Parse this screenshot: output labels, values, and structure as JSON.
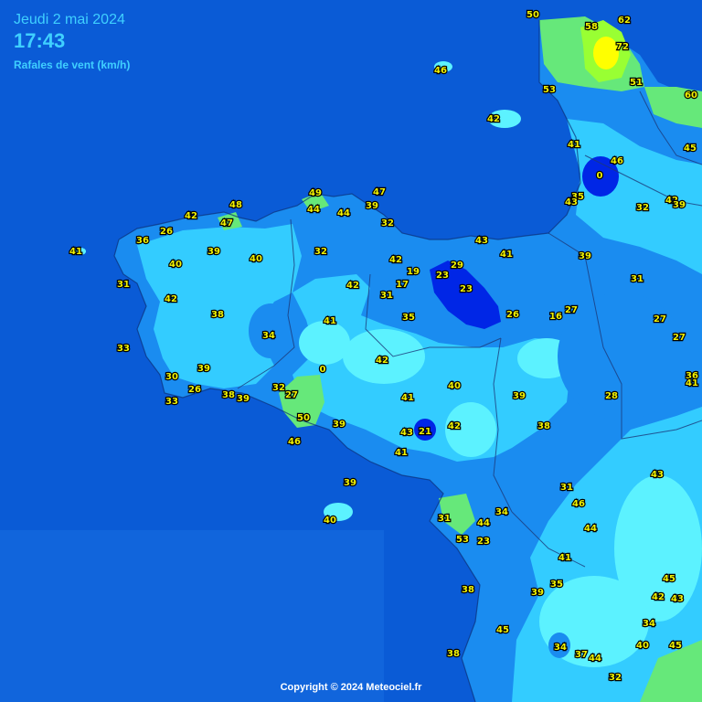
{
  "header": {
    "date": "Jeudi 2 mai 2024",
    "time": "17:43",
    "subtitle": "Rafales de vent (km/h)"
  },
  "footer": {
    "copyright": "Copyright © 2024 Meteociel.fr"
  },
  "colors": {
    "sea": "#0a5bd6",
    "sea_light": "#1f78e8",
    "land_light": "#33ccff",
    "land_mid": "#1a8cf0",
    "land_dark": "#0026e6",
    "cyan": "#5cf2ff",
    "green": "#66e87a",
    "lime": "#99ff33",
    "yellow": "#ffff00",
    "label": "#f2f200"
  },
  "stations": [
    {
      "id": "s1",
      "value": "50"
    },
    {
      "id": "s2",
      "value": "58"
    },
    {
      "id": "s3",
      "value": "62"
    },
    {
      "id": "s4",
      "value": "72"
    },
    {
      "id": "s5",
      "value": "46"
    },
    {
      "id": "s6",
      "value": "53"
    },
    {
      "id": "s7",
      "value": "51"
    },
    {
      "id": "s8",
      "value": "60"
    },
    {
      "id": "s9",
      "value": "42"
    },
    {
      "id": "s10",
      "value": "41"
    },
    {
      "id": "s11",
      "value": "46"
    },
    {
      "id": "s12",
      "value": "45"
    },
    {
      "id": "s13",
      "value": "0"
    },
    {
      "id": "s14",
      "value": "35"
    },
    {
      "id": "s15",
      "value": "43"
    },
    {
      "id": "s16",
      "value": "32"
    },
    {
      "id": "s17",
      "value": "42"
    },
    {
      "id": "s18",
      "value": "39"
    },
    {
      "id": "s19",
      "value": "48"
    },
    {
      "id": "s20",
      "value": "49"
    },
    {
      "id": "s21",
      "value": "47"
    },
    {
      "id": "s22",
      "value": "42"
    },
    {
      "id": "s23",
      "value": "44"
    },
    {
      "id": "s24",
      "value": "44"
    },
    {
      "id": "s25",
      "value": "39"
    },
    {
      "id": "s26",
      "value": "47"
    },
    {
      "id": "s27",
      "value": "26"
    },
    {
      "id": "s28",
      "value": "32"
    },
    {
      "id": "s29",
      "value": "36"
    },
    {
      "id": "s30",
      "value": "43"
    },
    {
      "id": "s31",
      "value": "41"
    },
    {
      "id": "s32",
      "value": "41"
    },
    {
      "id": "s33",
      "value": "39"
    },
    {
      "id": "s34",
      "value": "32"
    },
    {
      "id": "s35",
      "value": "39"
    },
    {
      "id": "s36",
      "value": "40"
    },
    {
      "id": "s37",
      "value": "42"
    },
    {
      "id": "s38",
      "value": "29"
    },
    {
      "id": "s39",
      "value": "31"
    },
    {
      "id": "s40",
      "value": "19"
    },
    {
      "id": "s41",
      "value": "23"
    },
    {
      "id": "s42",
      "value": "31"
    },
    {
      "id": "s43",
      "value": "40"
    },
    {
      "id": "s44",
      "value": "42"
    },
    {
      "id": "s45",
      "value": "17"
    },
    {
      "id": "s46",
      "value": "23"
    },
    {
      "id": "s47",
      "value": "31"
    },
    {
      "id": "s48",
      "value": "27"
    },
    {
      "id": "s49",
      "value": "38"
    },
    {
      "id": "s50",
      "value": "41"
    },
    {
      "id": "s51",
      "value": "35"
    },
    {
      "id": "s52",
      "value": "26"
    },
    {
      "id": "s53",
      "value": "16"
    },
    {
      "id": "s54",
      "value": "27"
    },
    {
      "id": "s55",
      "value": "33"
    },
    {
      "id": "s56",
      "value": "34"
    },
    {
      "id": "s57",
      "value": "27"
    },
    {
      "id": "s58",
      "value": "42"
    },
    {
      "id": "s59",
      "value": "39"
    },
    {
      "id": "s60",
      "value": "0"
    },
    {
      "id": "s61",
      "value": "42"
    },
    {
      "id": "s62",
      "value": "36"
    },
    {
      "id": "s63",
      "value": "41"
    },
    {
      "id": "s64",
      "value": "30"
    },
    {
      "id": "s65",
      "value": "40"
    },
    {
      "id": "s66",
      "value": "26"
    },
    {
      "id": "s67",
      "value": "38"
    },
    {
      "id": "s68",
      "value": "39"
    },
    {
      "id": "s69",
      "value": "32"
    },
    {
      "id": "s70",
      "value": "27"
    },
    {
      "id": "s71",
      "value": "41"
    },
    {
      "id": "s72",
      "value": "39"
    },
    {
      "id": "s73",
      "value": "28"
    },
    {
      "id": "s74",
      "value": "33"
    },
    {
      "id": "s75",
      "value": "50"
    },
    {
      "id": "s76",
      "value": "39"
    },
    {
      "id": "s77",
      "value": "21"
    },
    {
      "id": "s78",
      "value": "42"
    },
    {
      "id": "s79",
      "value": "38"
    },
    {
      "id": "s80",
      "value": "46"
    },
    {
      "id": "s81",
      "value": "43"
    },
    {
      "id": "s82",
      "value": "41"
    },
    {
      "id": "s83",
      "value": "39"
    },
    {
      "id": "s84",
      "value": "31"
    },
    {
      "id": "s85",
      "value": "43"
    },
    {
      "id": "s86",
      "value": "34"
    },
    {
      "id": "s87",
      "value": "46"
    },
    {
      "id": "s88",
      "value": "40"
    },
    {
      "id": "s89",
      "value": "31"
    },
    {
      "id": "s90",
      "value": "44"
    },
    {
      "id": "s91",
      "value": "44"
    },
    {
      "id": "s92",
      "value": "53"
    },
    {
      "id": "s93",
      "value": "23"
    },
    {
      "id": "s94",
      "value": "41"
    },
    {
      "id": "s95",
      "value": "45"
    },
    {
      "id": "s96",
      "value": "35"
    },
    {
      "id": "s97",
      "value": "39"
    },
    {
      "id": "s98",
      "value": "38"
    },
    {
      "id": "s99",
      "value": "42"
    },
    {
      "id": "s100",
      "value": "43"
    },
    {
      "id": "s101",
      "value": "45"
    },
    {
      "id": "s102",
      "value": "34"
    },
    {
      "id": "s103",
      "value": "34"
    },
    {
      "id": "s104",
      "value": "37"
    },
    {
      "id": "s105",
      "value": "44"
    },
    {
      "id": "s106",
      "value": "40"
    },
    {
      "id": "s107",
      "value": "45"
    },
    {
      "id": "s108",
      "value": "38"
    },
    {
      "id": "s109",
      "value": "32"
    }
  ]
}
